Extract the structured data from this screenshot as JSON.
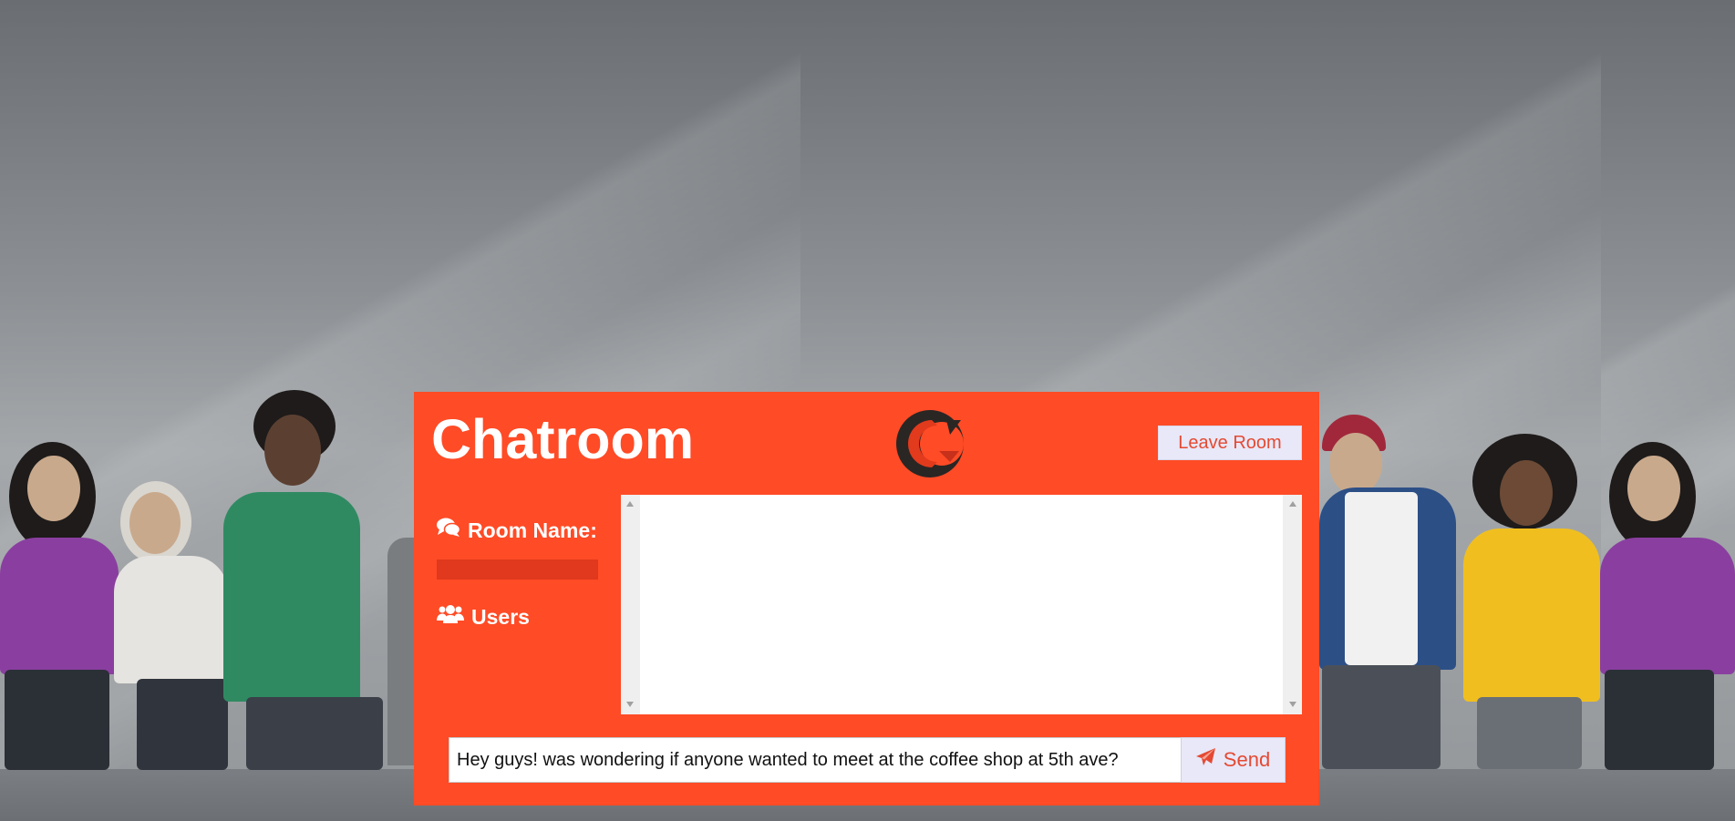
{
  "header": {
    "title": "Chatroom",
    "leave_label": "Leave Room",
    "logo_icon": "chatroom-c-logo-icon"
  },
  "sidebar": {
    "room_label": "Room Name:",
    "room_icon": "comments-icon",
    "room_value": "",
    "users_label": "Users",
    "users_icon": "users-icon"
  },
  "messages": {
    "items": []
  },
  "composer": {
    "input_value": "Hey guys! was wondering if anyone wanted to meet at the coffee shop at 5th ave?",
    "send_label": "Send",
    "send_icon": "paper-plane-icon"
  },
  "colors": {
    "accent": "#ff4b26",
    "button_bg": "#e8e8f8",
    "button_text": "#e44a33"
  }
}
